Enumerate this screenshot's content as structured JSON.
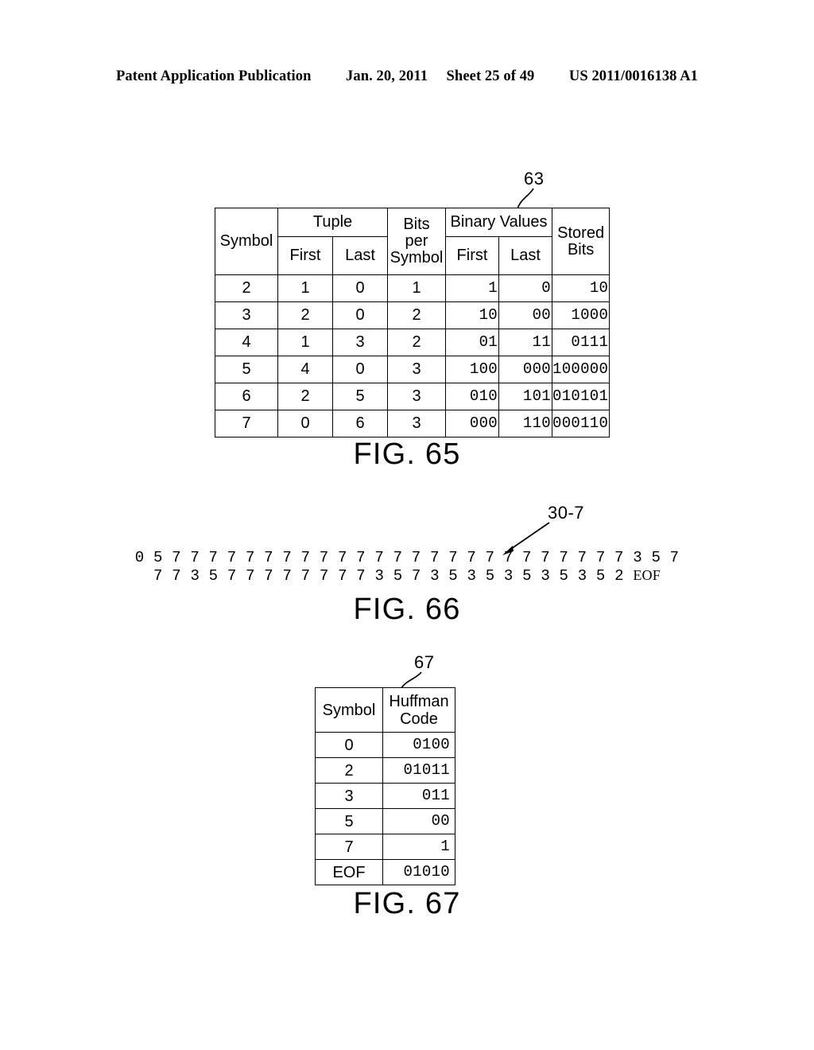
{
  "header": {
    "publication": "Patent Application Publication",
    "date": "Jan. 20, 2011",
    "sheet": "Sheet 25 of 49",
    "patent_number": "US 2011/0016138 A1"
  },
  "figures": [
    {
      "caption": "FIG. 65",
      "ref_label": "63",
      "table": {
        "header_groups": {
          "symbol": "Symbol",
          "tuple": "Tuple",
          "tuple_first": "First",
          "tuple_last": "Last",
          "bits_per_symbol": "Bits\nper\nSymbol",
          "bits_per_symbol_lines": [
            "Bits",
            "per",
            "Symbol"
          ],
          "binary_values": "Binary Values",
          "binary_first": "First",
          "binary_last": "Last",
          "stored_bits": "Stored\nBits",
          "stored_bits_lines": [
            "Stored",
            "Bits"
          ]
        },
        "rows": [
          {
            "symbol": "2",
            "tuple_first": "1",
            "tuple_last": "0",
            "bits_per_symbol": "1",
            "binary_first": "1",
            "binary_last": "0",
            "stored_bits": "10"
          },
          {
            "symbol": "3",
            "tuple_first": "2",
            "tuple_last": "0",
            "bits_per_symbol": "2",
            "binary_first": "10",
            "binary_last": "00",
            "stored_bits": "1000"
          },
          {
            "symbol": "4",
            "tuple_first": "1",
            "tuple_last": "3",
            "bits_per_symbol": "2",
            "binary_first": "01",
            "binary_last": "11",
            "stored_bits": "0111"
          },
          {
            "symbol": "5",
            "tuple_first": "4",
            "tuple_last": "0",
            "bits_per_symbol": "3",
            "binary_first": "100",
            "binary_last": "000",
            "stored_bits": "100000"
          },
          {
            "symbol": "6",
            "tuple_first": "2",
            "tuple_last": "5",
            "bits_per_symbol": "3",
            "binary_first": "010",
            "binary_last": "101",
            "stored_bits": "010101"
          },
          {
            "symbol": "7",
            "tuple_first": "0",
            "tuple_last": "6",
            "bits_per_symbol": "3",
            "binary_first": "000",
            "binary_last": "110",
            "stored_bits": "000110"
          }
        ]
      }
    },
    {
      "caption": "FIG. 66",
      "ref_label": "30-7",
      "symbol_stream": {
        "line1": "0 5 7 7 7 7 7 7 7 7 7 7 7 7 7 7 7 7 7 7 7 7 7 7 7 7 7 3 5 7",
        "line2_symbols": "7 7 3 5 7 7 7 7 7 7 7 7 3 5 7 3 5 3 5 3 5 3 5 3 5 2 ",
        "line2_eof": "EOF"
      }
    },
    {
      "caption": "FIG. 67",
      "ref_label": "67",
      "table": {
        "columns": [
          "Symbol",
          "Huffman\nCode"
        ],
        "col_symbol": "Symbol",
        "col_code_lines": [
          "Huffman",
          "Code"
        ],
        "rows": [
          {
            "symbol": "0",
            "code": "0100"
          },
          {
            "symbol": "2",
            "code": "01011"
          },
          {
            "symbol": "3",
            "code": "011"
          },
          {
            "symbol": "5",
            "code": "00"
          },
          {
            "symbol": "7",
            "code": "1"
          },
          {
            "symbol": "EOF",
            "code": "01010"
          }
        ]
      }
    }
  ]
}
